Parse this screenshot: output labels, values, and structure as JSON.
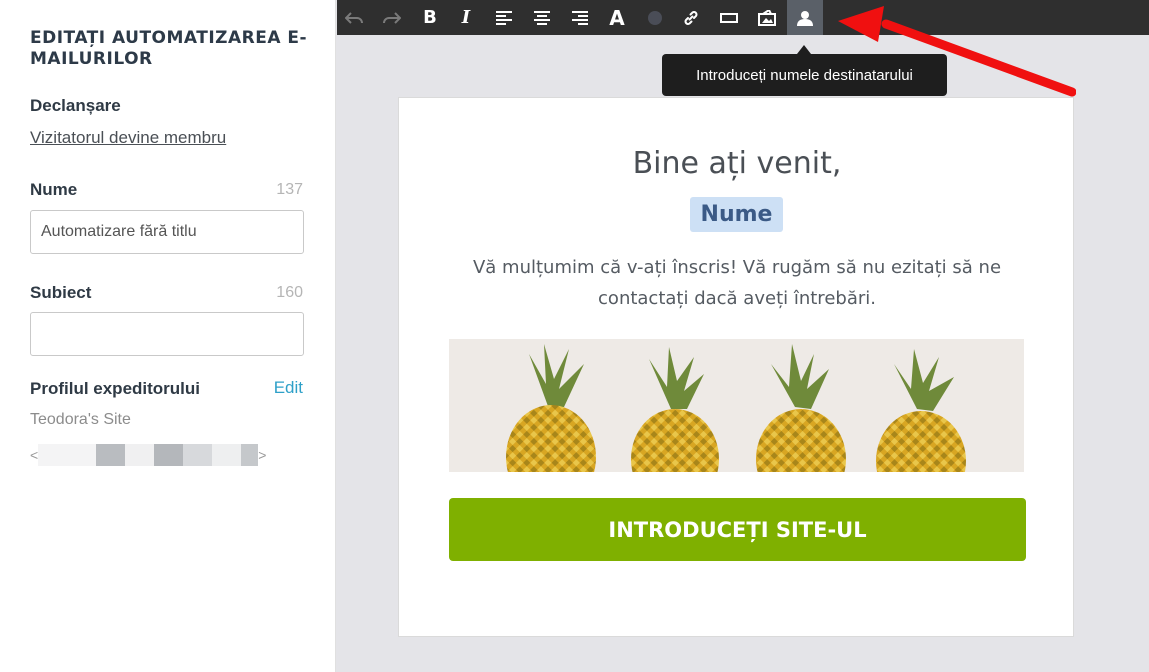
{
  "sidebar": {
    "title": "EDITAȚI AUTOMATIZAREA E-MAILURILOR",
    "trigger_label": "Declanșare",
    "trigger_value": "Vizitatorul devine membru",
    "name_label": "Nume",
    "name_count": "137",
    "name_value": "Automatizare fără titlu",
    "subject_label": "Subiect",
    "subject_count": "160",
    "subject_value": "",
    "sender_label": "Profilul expeditorului",
    "edit_label": "Edit",
    "site_name": "Teodora's Site",
    "email_open": "<",
    "email_close": ">"
  },
  "toolbar": {
    "buttons": [
      {
        "name": "undo-icon",
        "glyph": "↶"
      },
      {
        "name": "redo-icon",
        "glyph": "↷"
      },
      {
        "name": "bold-icon",
        "glyph": "B"
      },
      {
        "name": "italic-icon",
        "glyph": "I"
      },
      {
        "name": "align-left-icon",
        "glyph": "≡"
      },
      {
        "name": "align-center-icon",
        "glyph": "≡"
      },
      {
        "name": "align-right-icon",
        "glyph": "≡"
      },
      {
        "name": "font-icon",
        "glyph": "A"
      },
      {
        "name": "color-icon",
        "glyph": "●"
      },
      {
        "name": "link-icon",
        "glyph": "🔗"
      },
      {
        "name": "button-icon",
        "glyph": "▭"
      },
      {
        "name": "image-icon",
        "glyph": "▣"
      },
      {
        "name": "recipient-icon",
        "glyph": "👤"
      }
    ]
  },
  "tooltip": {
    "text": "Introduceți numele destinatarului"
  },
  "email": {
    "greeting": "Bine ați venit,",
    "name_placeholder": "Nume",
    "body": "Vă mulțumim că v-ați înscris! Vă rugăm să nu ezitați să ne contactați dacă aveți întrebări.",
    "cta_label": "INTRODUCEȚI SITE-UL"
  },
  "colors": {
    "cta": "#7fb000",
    "link": "#2ea0c8",
    "annotation_arrow": "#f01010"
  }
}
